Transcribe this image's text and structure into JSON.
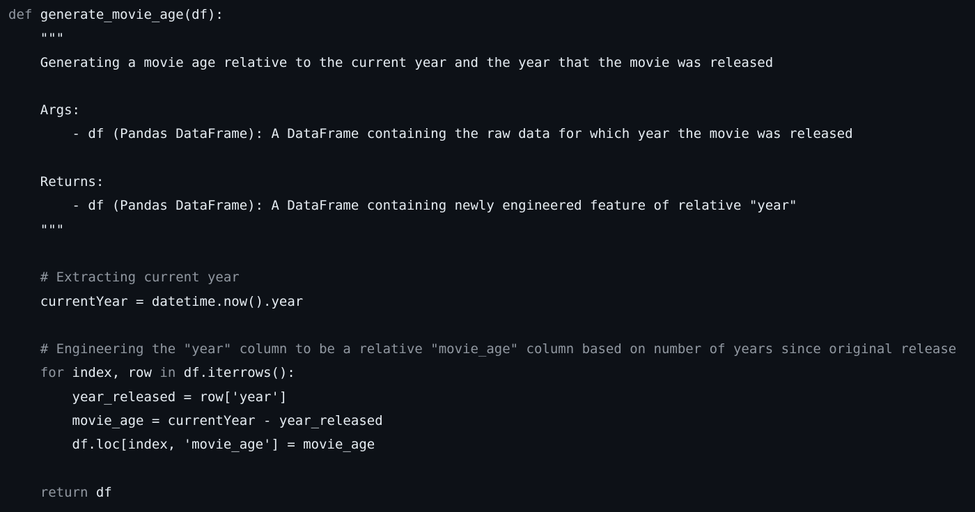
{
  "colors": {
    "background": "#0d1117",
    "text": "#e6edf3",
    "keyword": "#9198a1",
    "comment": "#9198a1"
  },
  "code": {
    "lines": [
      [
        {
          "t": "def",
          "c": "kw"
        },
        {
          "t": " generate_movie_age(df):",
          "c": "plain"
        }
      ],
      [
        {
          "t": "    \"\"\"",
          "c": "str"
        }
      ],
      [
        {
          "t": "    Generating a movie age relative to the current year and the year that the movie was released",
          "c": "str"
        }
      ],
      [],
      [
        {
          "t": "    Args:",
          "c": "str"
        }
      ],
      [
        {
          "t": "        - df (Pandas DataFrame): A DataFrame containing the raw data for which year the movie was released",
          "c": "str"
        }
      ],
      [],
      [
        {
          "t": "    Returns:",
          "c": "str"
        }
      ],
      [
        {
          "t": "        - df (Pandas DataFrame): A DataFrame containing newly engineered feature of relative \"year\"",
          "c": "str"
        }
      ],
      [
        {
          "t": "    \"\"\"",
          "c": "str"
        }
      ],
      [],
      [
        {
          "t": "    # Extracting current year",
          "c": "comment"
        }
      ],
      [
        {
          "t": "    currentYear = datetime.now().year",
          "c": "plain"
        }
      ],
      [],
      [
        {
          "t": "    # Engineering the \"year\" column to be a relative \"movie_age\" column based on number of years since original release",
          "c": "comment"
        }
      ],
      [
        {
          "t": "    ",
          "c": "plain"
        },
        {
          "t": "for",
          "c": "kw"
        },
        {
          "t": " index, row ",
          "c": "plain"
        },
        {
          "t": "in",
          "c": "kw"
        },
        {
          "t": " df.iterrows():",
          "c": "plain"
        }
      ],
      [
        {
          "t": "        year_released = row['year']",
          "c": "plain"
        }
      ],
      [
        {
          "t": "        movie_age = currentYear - year_released",
          "c": "plain"
        }
      ],
      [
        {
          "t": "        df.loc[index, 'movie_age'] = movie_age",
          "c": "plain"
        }
      ],
      [],
      [
        {
          "t": "    ",
          "c": "plain"
        },
        {
          "t": "return",
          "c": "kw"
        },
        {
          "t": " df",
          "c": "plain"
        }
      ]
    ]
  }
}
